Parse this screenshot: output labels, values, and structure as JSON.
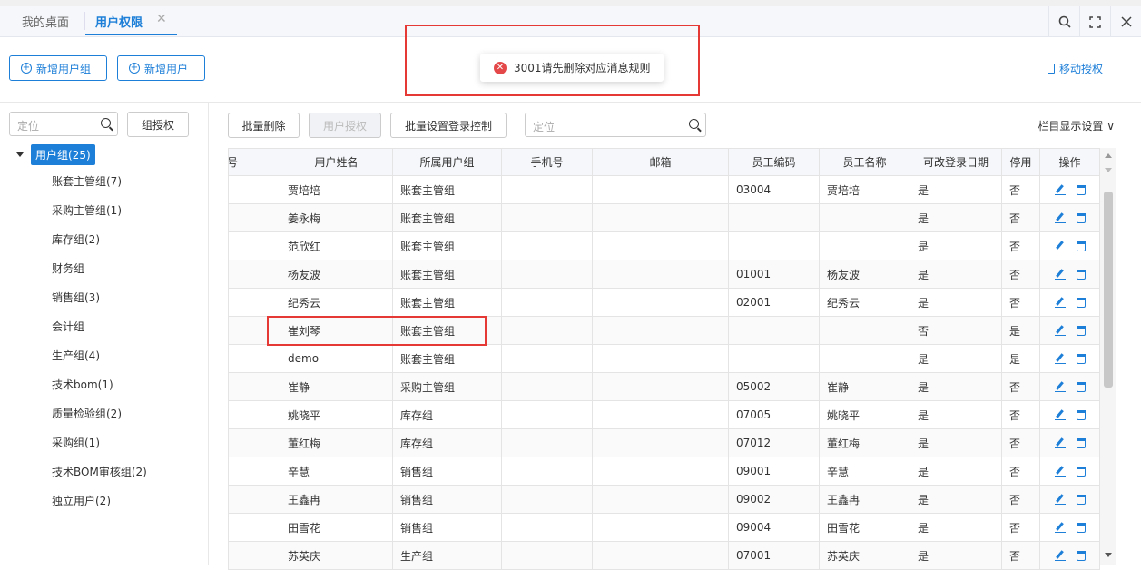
{
  "tabs": {
    "desk": "我的桌面",
    "perm": "用户权限",
    "close": "✕"
  },
  "window_icons": [
    "search-icon",
    "fullscreen-icon",
    "close-icon"
  ],
  "toolbar": {
    "add_group": "新增用户组",
    "add_user": "新增用户",
    "mobile_auth": "移动授权"
  },
  "toast": {
    "message": "3001请先删除对应消息规则",
    "icon": "error-icon"
  },
  "left": {
    "search_placeholder": "定位",
    "group_auth": "组授权",
    "root": "用户组(25)",
    "items": [
      "账套主管组(7)",
      "采购主管组(1)",
      "库存组(2)",
      "财务组",
      "销售组(3)",
      "会计组",
      "生产组(4)",
      "技术bom(1)",
      "质量检验组(2)",
      "采购组(1)",
      "技术BOM审核组(2)",
      "独立用户(2)"
    ]
  },
  "right": {
    "batch_delete": "批量删除",
    "user_auth": "用户授权",
    "batch_login": "批量设置登录控制",
    "search_placeholder": "定位",
    "col_settings": "栏目显示设置 ∨"
  },
  "table": {
    "headers": [
      "账号",
      "用户姓名",
      "所属用户组",
      "手机号",
      "邮箱",
      "员工编码",
      "员工名称",
      "可改登录日期",
      "停用",
      "操作"
    ],
    "rows": [
      [
        "",
        "贾培培",
        "账套主管组",
        "",
        "",
        "03004",
        "贾培培",
        "是",
        "否"
      ],
      [
        "",
        "姜永梅",
        "账套主管组",
        "",
        "",
        "",
        "",
        "是",
        "否"
      ],
      [
        "",
        "范欣红",
        "账套主管组",
        "",
        "",
        "",
        "",
        "是",
        "否"
      ],
      [
        "",
        "杨友波",
        "账套主管组",
        "",
        "",
        "01001",
        "杨友波",
        "是",
        "否"
      ],
      [
        "",
        "纪秀云",
        "账套主管组",
        "",
        "",
        "02001",
        "纪秀云",
        "是",
        "否"
      ],
      [
        "",
        "崔刘琴",
        "账套主管组",
        "",
        "",
        "",
        "",
        "否",
        "是"
      ],
      [
        "",
        "demo",
        "账套主管组",
        "",
        "",
        "",
        "",
        "是",
        "是"
      ],
      [
        "",
        "崔静",
        "采购主管组",
        "",
        "",
        "05002",
        "崔静",
        "是",
        "否"
      ],
      [
        "",
        "姚晓平",
        "库存组",
        "",
        "",
        "07005",
        "姚晓平",
        "是",
        "否"
      ],
      [
        "",
        "董红梅",
        "库存组",
        "",
        "",
        "07012",
        "董红梅",
        "是",
        "否"
      ],
      [
        "",
        "辛慧",
        "销售组",
        "",
        "",
        "09001",
        "辛慧",
        "是",
        "否"
      ],
      [
        "",
        "王鑫冉",
        "销售组",
        "",
        "",
        "09002",
        "王鑫冉",
        "是",
        "否"
      ],
      [
        "",
        "田雪花",
        "销售组",
        "",
        "",
        "09004",
        "田雪花",
        "是",
        "否"
      ],
      [
        "",
        "苏英庆",
        "生产组",
        "",
        "",
        "07001",
        "苏英庆",
        "是",
        "否"
      ]
    ]
  },
  "colors": {
    "accent": "#1e7fd8",
    "highlight": "#e53935",
    "error": "#e54848"
  }
}
